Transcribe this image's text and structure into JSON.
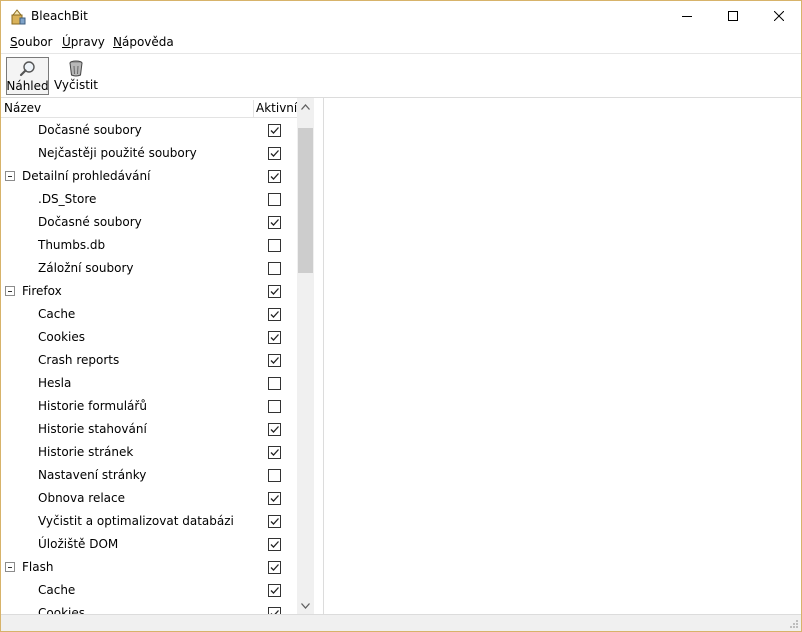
{
  "window": {
    "title": "BleachBit"
  },
  "menu": [
    {
      "first": "S",
      "rest": "oubor"
    },
    {
      "first": "Ú",
      "rest": "pravy"
    },
    {
      "first": "N",
      "rest": "ápověda"
    }
  ],
  "toolbar": {
    "preview_label": "Náhled",
    "clean_label": "Vyčistit"
  },
  "tree": {
    "col_name": "Název",
    "col_active": "Aktivní",
    "rows": [
      {
        "label": "Dočasné soubory",
        "level": "child",
        "checked": true
      },
      {
        "label": "Nejčastěji použité soubory",
        "level": "child",
        "checked": true
      },
      {
        "label": "Detailní prohledávání",
        "level": "parent",
        "checked": true
      },
      {
        "label": ".DS_Store",
        "level": "child",
        "checked": false
      },
      {
        "label": "Dočasné soubory",
        "level": "child",
        "checked": true
      },
      {
        "label": "Thumbs.db",
        "level": "child",
        "checked": false
      },
      {
        "label": "Záložní soubory",
        "level": "child",
        "checked": false
      },
      {
        "label": "Firefox",
        "level": "parent",
        "checked": true
      },
      {
        "label": "Cache",
        "level": "child",
        "checked": true
      },
      {
        "label": "Cookies",
        "level": "child",
        "checked": true
      },
      {
        "label": "Crash reports",
        "level": "child",
        "checked": true
      },
      {
        "label": "Hesla",
        "level": "child",
        "checked": false
      },
      {
        "label": "Historie formulářů",
        "level": "child",
        "checked": false
      },
      {
        "label": "Historie stahování",
        "level": "child",
        "checked": true
      },
      {
        "label": "Historie stránek",
        "level": "child",
        "checked": true
      },
      {
        "label": "Nastavení stránky",
        "level": "child",
        "checked": false
      },
      {
        "label": "Obnova relace",
        "level": "child",
        "checked": true
      },
      {
        "label": "Vyčistit a optimalizovat databázi",
        "level": "child",
        "checked": true
      },
      {
        "label": "Úložiště DOM",
        "level": "child",
        "checked": true
      },
      {
        "label": "Flash",
        "level": "parent",
        "checked": true
      },
      {
        "label": "Cache",
        "level": "child",
        "checked": true
      },
      {
        "label": "Cookies",
        "level": "child",
        "checked": true
      }
    ]
  },
  "icons": {
    "app": "bleachbit-app-icon",
    "preview": "magnifier-icon",
    "clean": "trash-can-icon"
  }
}
